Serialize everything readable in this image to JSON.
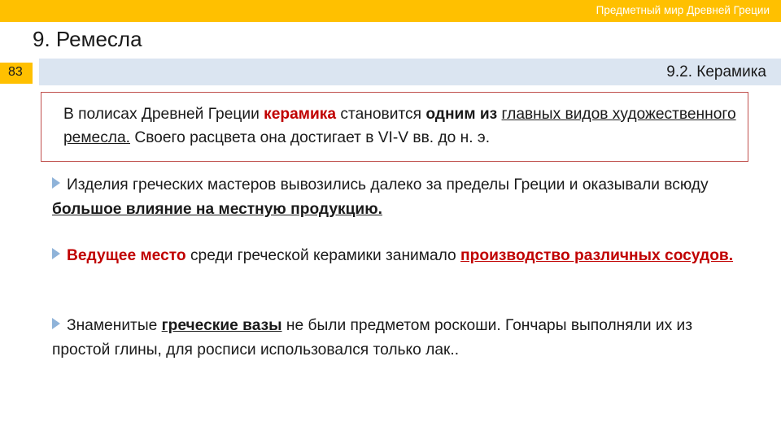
{
  "header": {
    "course_title": "Предметный мир Древней Греции",
    "section_title": "9. Ремесла",
    "slide_number": "83",
    "subsection_title": "9.2. Керамика"
  },
  "intro": {
    "s1": "В полисах Древней Греции ",
    "s2": "керамика",
    "s3": " становится ",
    "s4": "одним из ",
    "s5": "главных видов художественного ремесла.",
    "s6": " Своего расцвета она достигает в VI-V вв. до н. э."
  },
  "paragraphs": [
    {
      "s1": "Изделия греческих мастеров вывозились далеко за пределы Греции и оказывали всюду ",
      "s2": "большое влияние на местную продукцию."
    },
    {
      "s1": "Ведущее место",
      "s2": " среди греческой керамики занимало ",
      "s3": "производство различных сосудов."
    },
    {
      "s1": "Знаменитые ",
      "s2": "греческие вазы",
      "s3": " не были предметом роскоши. Гончары выполняли их из простой глины, для росписи использовался только лак.."
    }
  ],
  "colors": {
    "accent_yellow": "#ffc000",
    "subbar_blue": "#dbe5f1",
    "highlight_red": "#c00000",
    "box_border": "#c0504d",
    "bullet": "#8fb3d9"
  },
  "icons": {
    "bullet": "triangle-bullet-icon"
  }
}
